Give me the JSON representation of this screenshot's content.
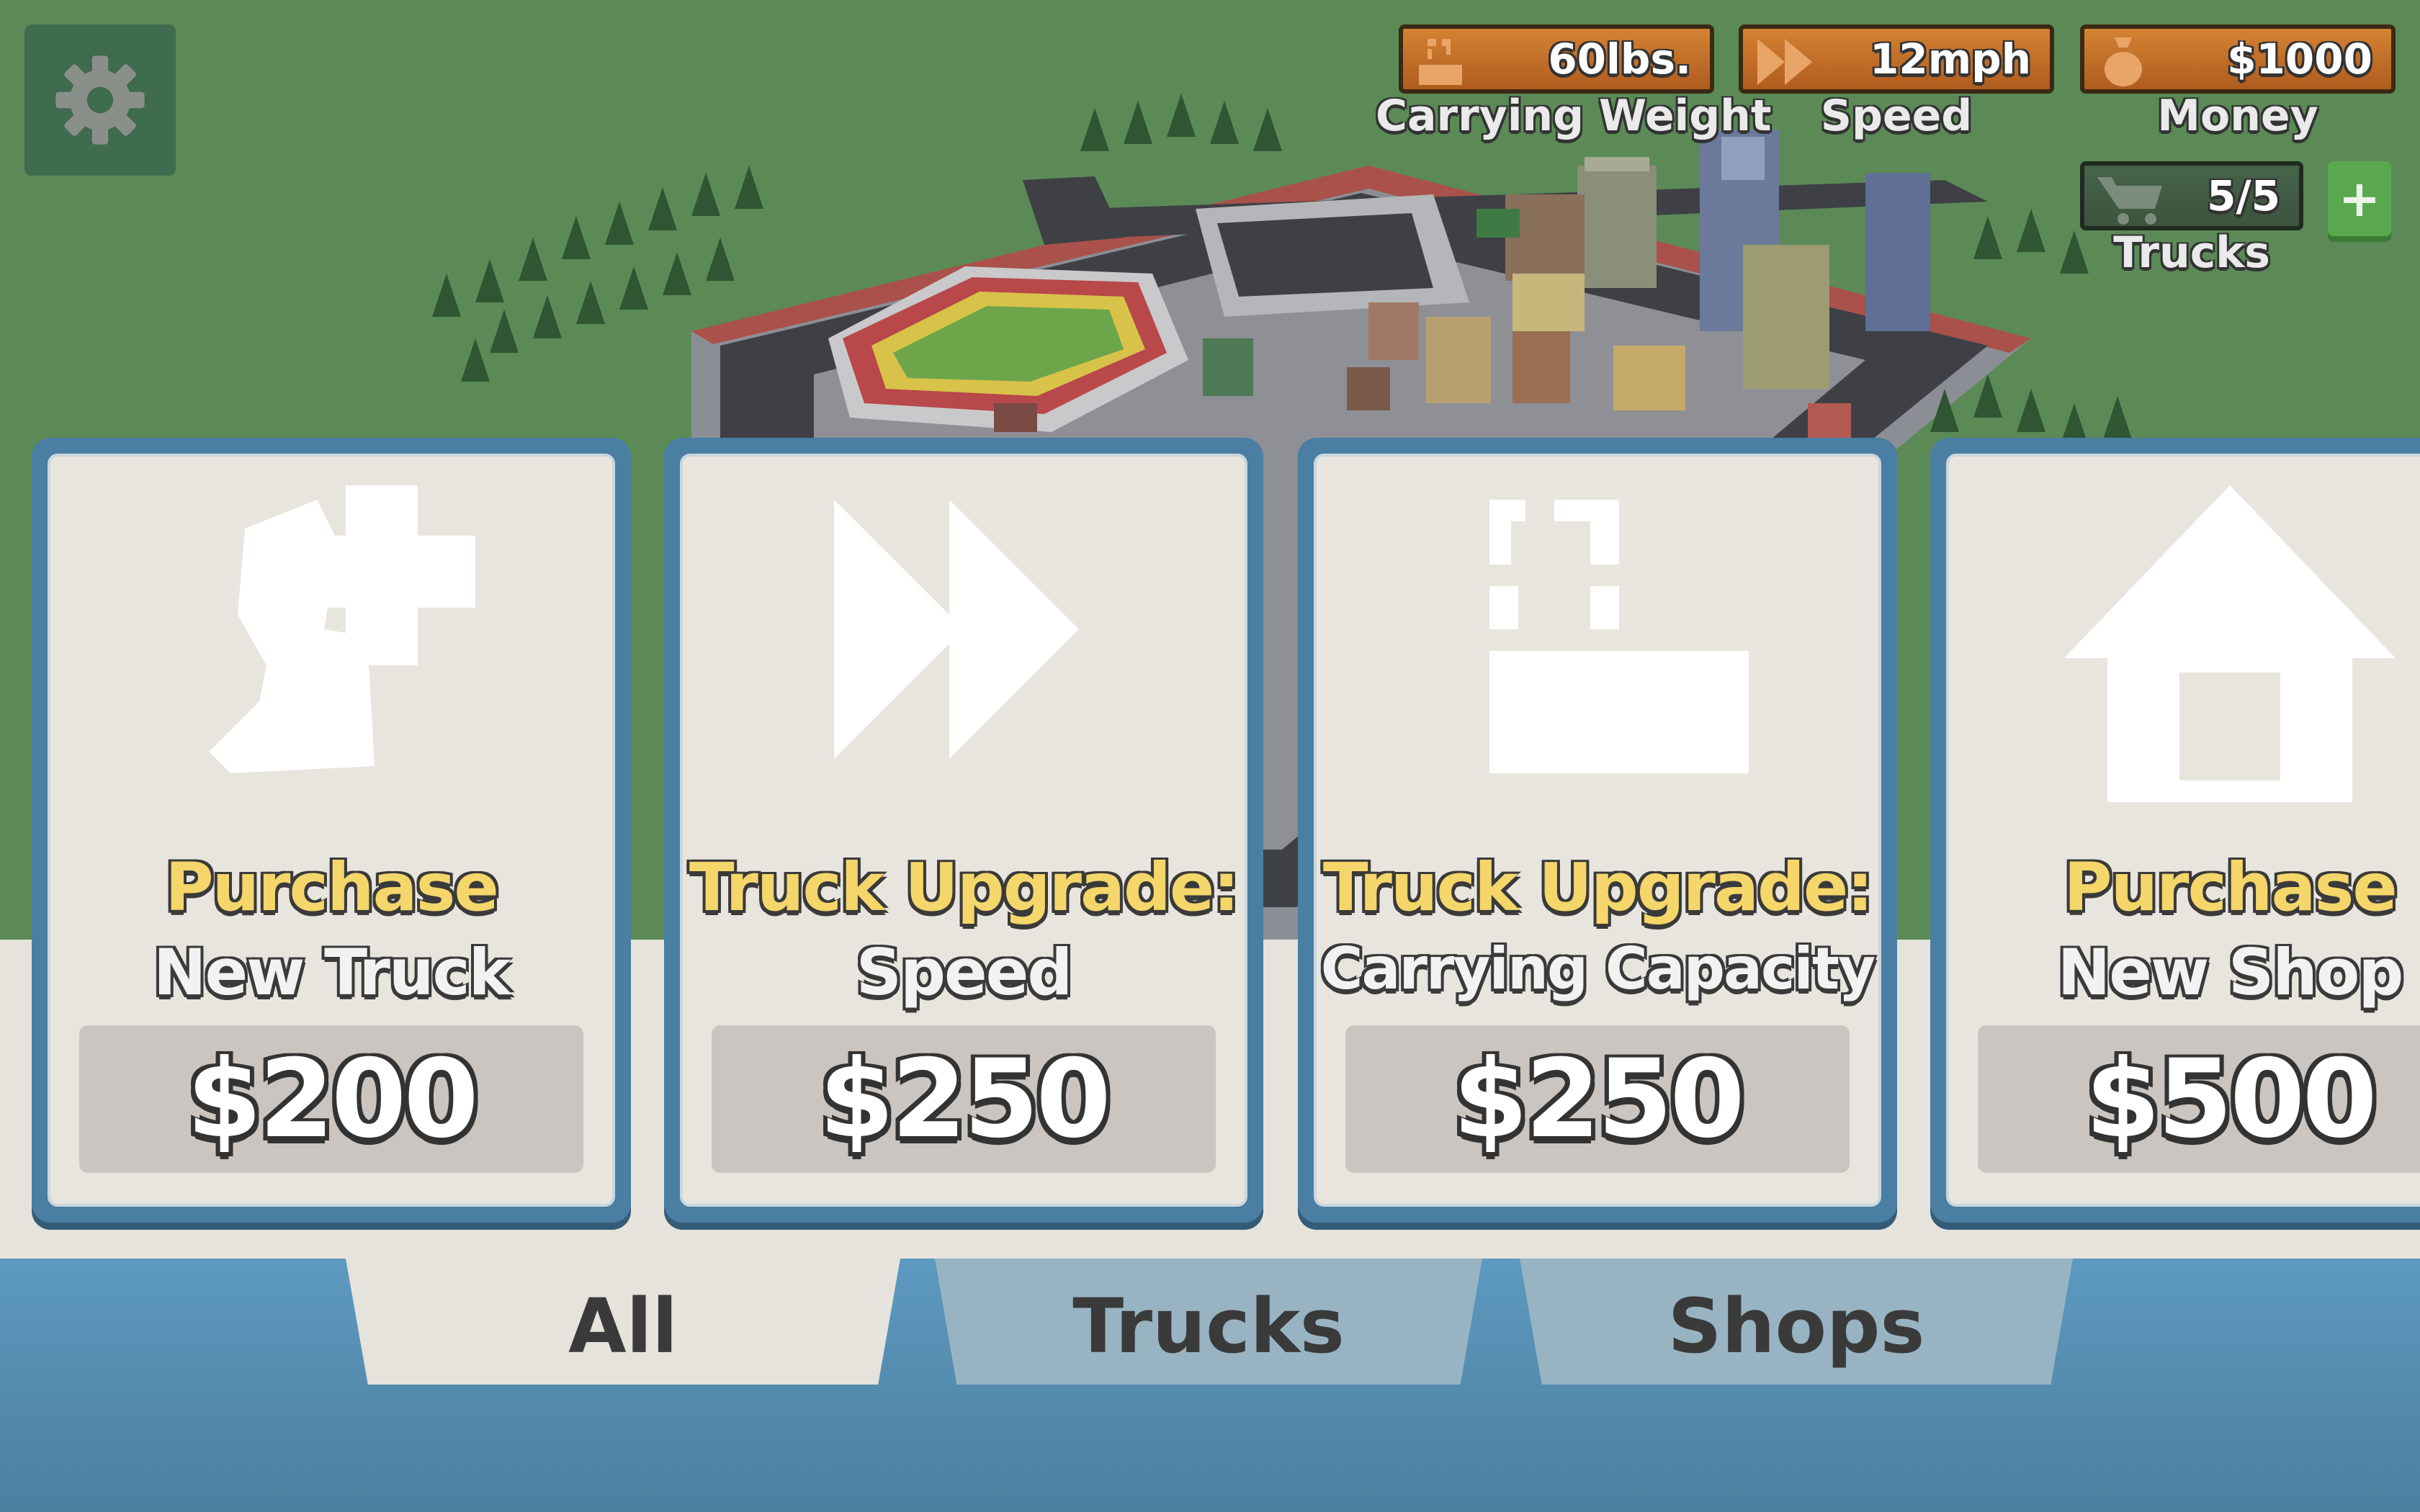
{
  "settings": {
    "icon": "gear-icon"
  },
  "hud": {
    "carrying_weight": {
      "value": "60lbs.",
      "label": "Carrying Weight"
    },
    "speed": {
      "value": "12mph",
      "label": "Speed"
    },
    "money": {
      "value": "$1000",
      "label": "Money"
    },
    "trucks": {
      "value": "5/5",
      "label": "Trucks"
    },
    "add_truck_label": "+"
  },
  "cards": [
    {
      "title": "Purchase",
      "subtitle": "New Truck",
      "price": "$200",
      "icon": "add-truck-icon"
    },
    {
      "title": "Truck Upgrade:",
      "subtitle": "Speed",
      "price": "$250",
      "icon": "fast-forward-icon"
    },
    {
      "title": "Truck Upgrade:",
      "subtitle": "Carrying Capacity",
      "price": "$250",
      "icon": "cargo-box-icon"
    },
    {
      "title": "Purchase",
      "subtitle": "New Shop",
      "price": "$500",
      "icon": "house-icon"
    }
  ],
  "tabs": [
    {
      "label": "All",
      "active": true
    },
    {
      "label": "Trucks",
      "active": false
    },
    {
      "label": "Shops",
      "active": false
    }
  ],
  "colors": {
    "card_border": "#4a7ea2",
    "title_yellow": "#f4d66a",
    "hud_orange": "#c56e29",
    "grass": "#5b8a56"
  }
}
